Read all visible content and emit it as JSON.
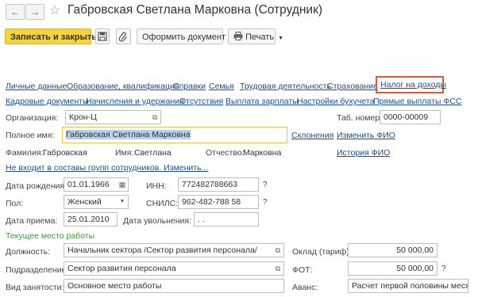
{
  "header": {
    "title": "Габровская Светлана Марковна (Сотрудник)",
    "back_symbol": "←",
    "forward_symbol": "→",
    "favorite_symbol": "☆"
  },
  "toolbar": {
    "save_close": "Записать и закрыть",
    "make_document": "Оформить документ",
    "print": "Печать"
  },
  "tabs_row1": [
    "Личные данные",
    "Образование, квалификация",
    "Справки",
    "Семья",
    "Трудовая деятельность",
    "Страхование",
    "Налог на доходы"
  ],
  "tabs_row2": [
    "Кадровые документы",
    "Начисления и удержания",
    "Отсутствия",
    "Выплата зарплаты",
    "Настройки бухучета",
    "Прямые выплаты ФСС"
  ],
  "highlight_color": "#e0583a",
  "form": {
    "org_label": "Организация:",
    "org_value": "Крон-Ц",
    "tab_label": "Таб. номер:",
    "tab_value": "0000-00009",
    "fullname_label": "Полное имя:",
    "fullname_value": "Габровская Светлана Марковна",
    "declensions": "Склонения",
    "change_fio": "Изменить ФИО",
    "surname_label": "Фамилия:",
    "surname_value": "Габровская",
    "name_label": "Имя:",
    "name_value": "Светлана",
    "patronymic_label": "Отчество:",
    "patronymic_value": "Марковна",
    "fio_history": "История ФИО",
    "groups_link": "Не входит в составы групп сотрудников. Изменить...",
    "birth_label": "Дата рождения:",
    "birth_value": "01.01.1966",
    "inn_label": "ИНН:",
    "inn_value": "772482788663",
    "gender_label": "Пол:",
    "gender_value": "Женский",
    "snils_label": "СНИЛС:",
    "snils_value": "962-482-788 58",
    "hire_label": "Дата приема:",
    "hire_value": "25.01.2010",
    "fire_label": "Дата увольнения:",
    "fire_value": " .  .",
    "section_label": "Текущее место работы",
    "position_label": "Должность:",
    "position_value": "Начальник сектора /Сектор развития персонала/",
    "salary_label": "Оклад (тариф):",
    "salary_value": "50 000,00",
    "dept_label": "Подразделение:",
    "dept_value": "Сектор развития персонала",
    "fot_label": "ФОТ:",
    "fot_value": "50 000,00",
    "employment_label": "Вид занятости:",
    "employment_value": "Основное место работы",
    "advance_label": "Аванс:",
    "advance_value": "Расчет первой половины месяца",
    "help_symbol": "?"
  }
}
